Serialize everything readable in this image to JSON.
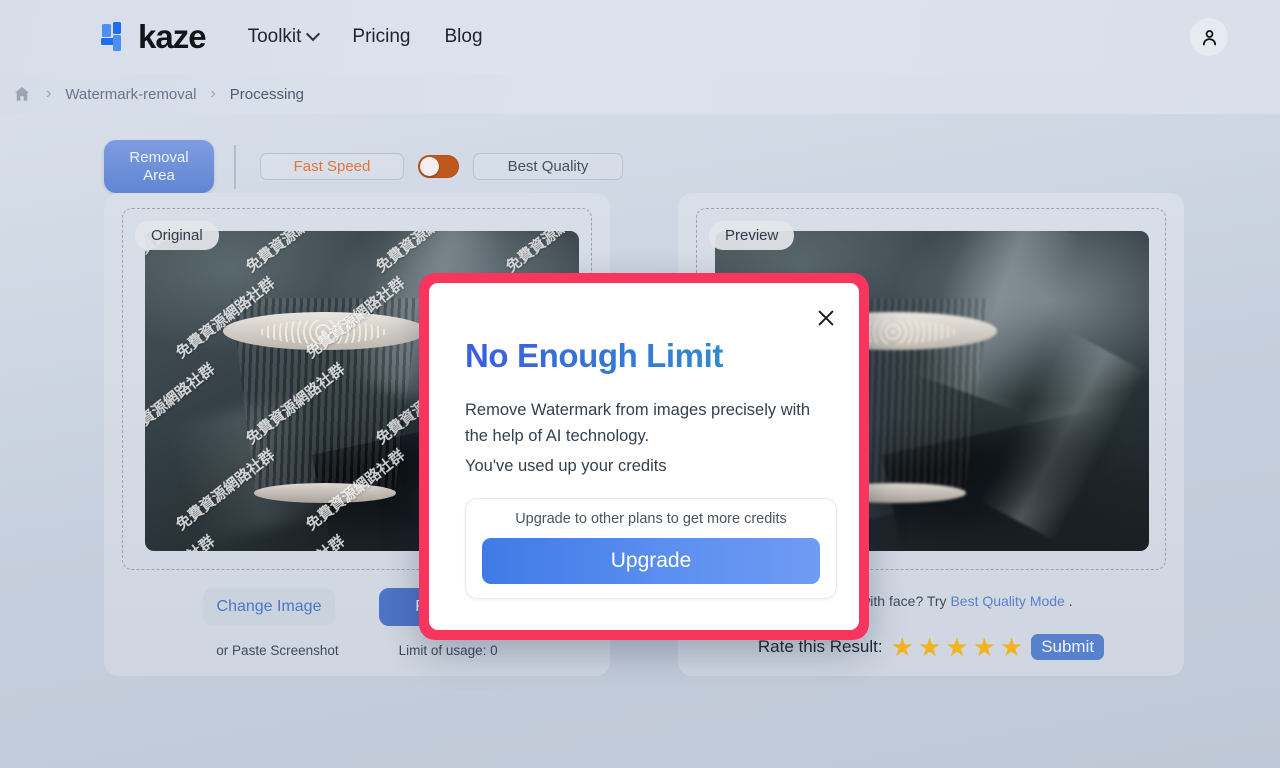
{
  "header": {
    "brand": "kaze",
    "nav": [
      {
        "label": "Toolkit",
        "has_chevron": true
      },
      {
        "label": "Pricing",
        "has_chevron": false
      },
      {
        "label": "Blog",
        "has_chevron": false
      }
    ],
    "avatar_icon": "user-icon"
  },
  "breadcrumb": {
    "home_icon": "home-icon",
    "separator": "›",
    "items": [
      "Watermark-removal",
      "Processing"
    ]
  },
  "toolbar": {
    "removal_area_label": "Removal\nArea",
    "removal_area_line1": "Removal",
    "removal_area_line2": "Area",
    "fast_speed_label": "Fast Speed",
    "best_quality_label": "Best Quality",
    "toggle_state": "right",
    "toggle_color": "#c0571b",
    "fast_speed_color": "#e2763a"
  },
  "panels": {
    "left": {
      "badge": "Original",
      "watermark_text": "免費資源網路社群",
      "buttons": {
        "change_image": "Change Image",
        "remove": "Remove"
      },
      "hints": {
        "paste": "or Paste Screenshot",
        "limit": "Limit of usage: 0"
      }
    },
    "right": {
      "badge": "Preview",
      "note_prefix": "unsatisfied with face? Try ",
      "note_link": "Best Quality Mode",
      "note_suffix": " .",
      "rate_label": "Rate this Result:",
      "star_count": 5,
      "star_color": "#efb420",
      "submit_label": "Submit"
    }
  },
  "modal": {
    "border_color": "#f8355f",
    "close_icon": "close-icon",
    "title": "No Enough Limit",
    "paragraph": "Remove Watermark from images precisely with the help of AI technology.",
    "paragraph2": "You've used up your credits",
    "upgrade_caption": "Upgrade to other plans to get more credits",
    "upgrade_button": "Upgrade"
  }
}
